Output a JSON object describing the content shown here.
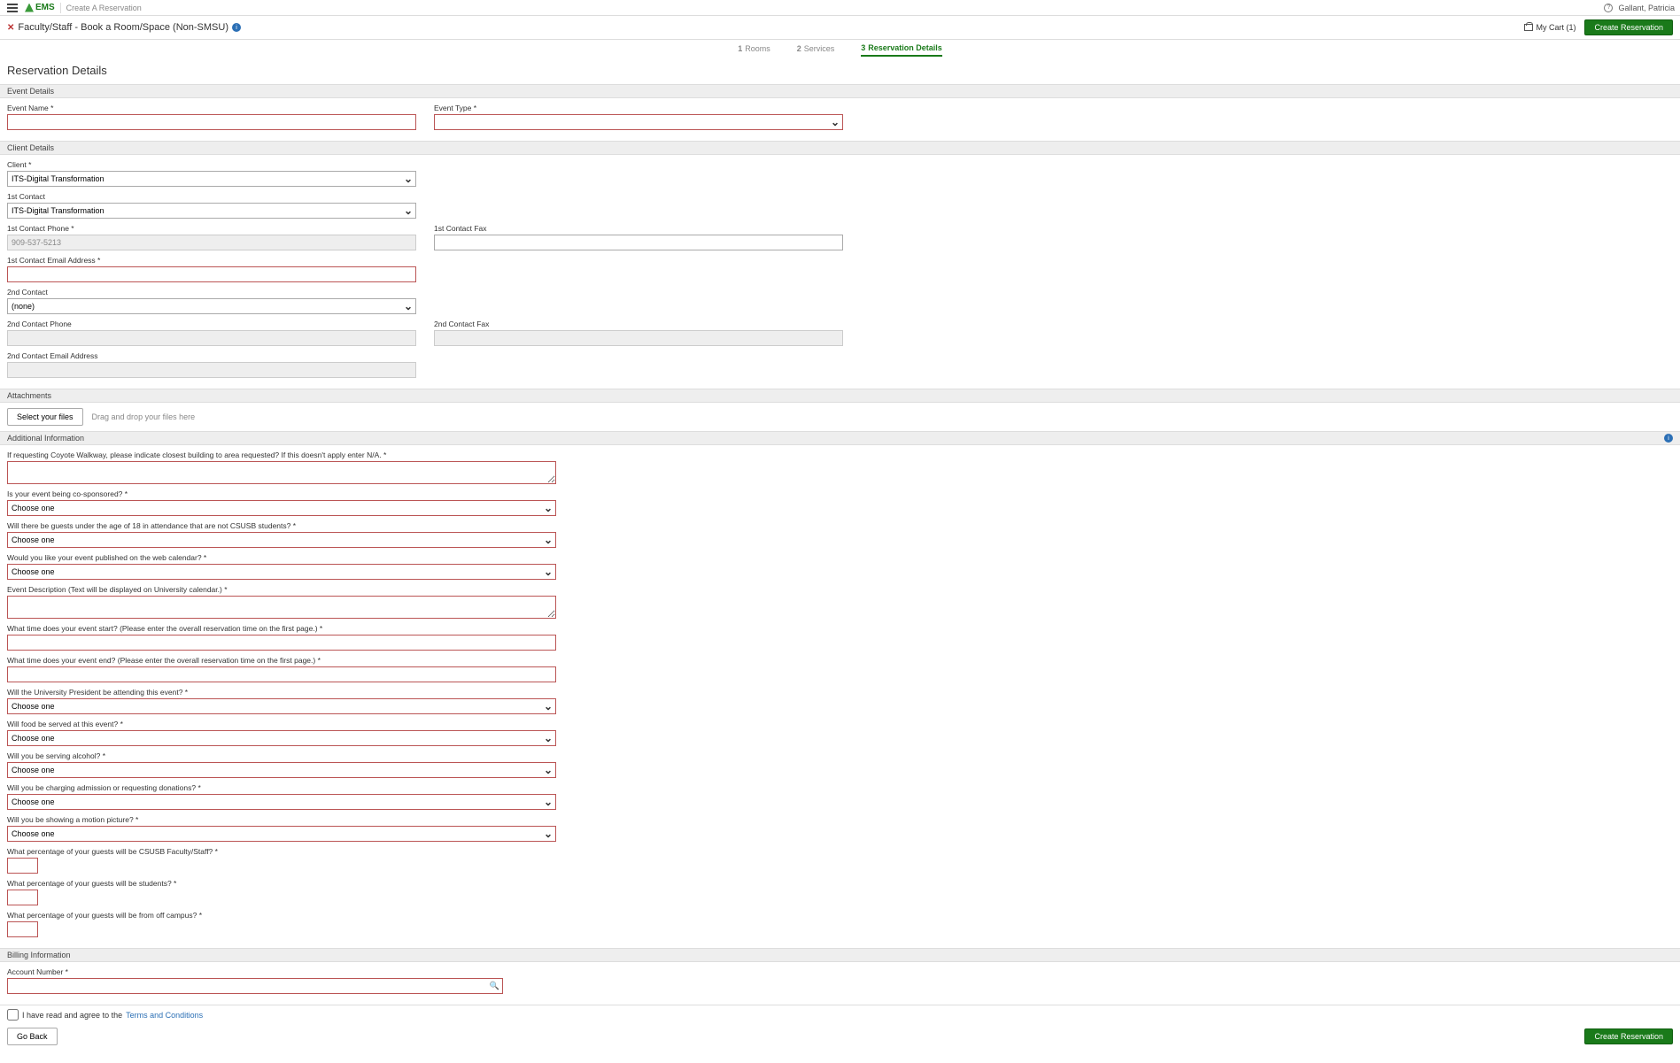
{
  "header": {
    "app_name": "EMS",
    "breadcrumb": "Create A Reservation",
    "user_name": "Gallant, Patricia"
  },
  "template": {
    "title": "Faculty/Staff - Book a Room/Space (Non-SMSU)",
    "cart_label": "My Cart (1)",
    "create_btn": "Create Reservation"
  },
  "tabs": {
    "rooms": {
      "num": "1",
      "label": "Rooms"
    },
    "services": {
      "num": "2",
      "label": "Services"
    },
    "details": {
      "num": "3",
      "label": "Reservation Details"
    }
  },
  "page_heading": "Reservation Details",
  "sections": {
    "event_details": "Event Details",
    "client_details": "Client Details",
    "attachments": "Attachments",
    "additional_info": "Additional Information",
    "billing_info": "Billing Information"
  },
  "event": {
    "name_label": "Event Name *",
    "type_label": "Event Type *"
  },
  "client": {
    "client_label": "Client *",
    "client_value": "ITS-Digital Transformation",
    "c1_label": "1st Contact",
    "c1_value": "ITS-Digital Transformation",
    "c1_phone_label": "1st Contact Phone *",
    "c1_phone_value": "909-537-5213",
    "c1_fax_label": "1st Contact Fax",
    "c1_email_label": "1st Contact Email Address *",
    "c2_label": "2nd Contact",
    "c2_value": "(none)",
    "c2_phone_label": "2nd Contact Phone",
    "c2_fax_label": "2nd Contact Fax",
    "c2_email_label": "2nd Contact Email Address"
  },
  "attach": {
    "select_btn": "Select your files",
    "drag_hint": "Drag and drop your files here"
  },
  "addl": {
    "coyote_walkway_label": "If requesting Coyote Walkway, please indicate closest building to area requested? If this doesn't apply enter N/A. *",
    "co_sponsored_label": "Is your event being co-sponsored? *",
    "under18_label": "Will there be guests under the age of 18 in attendance that are not CSUSB students? *",
    "publish_label": "Would you like your event published on the web calendar? *",
    "desc_label": "Event Description (Text will be displayed on University calendar.) *",
    "start_time_label": "What time does your event start? (Please enter the overall reservation time on the first page.) *",
    "end_time_label": "What time does your event end? (Please enter the overall reservation time on the first page.) *",
    "president_label": "Will the University President be attending this event? *",
    "food_label": "Will food be served at this event? *",
    "alcohol_label": "Will you be serving alcohol? *",
    "admission_label": "Will you be charging admission or requesting donations? *",
    "motion_label": "Will you be showing a motion picture? *",
    "pct_facstaff_label": "What percentage of your guests will be CSUSB Faculty/Staff? *",
    "pct_students_label": "What percentage of your guests will be students? *",
    "pct_offcampus_label": "What percentage of your guests will be from off campus? *",
    "choose_one": "Choose one"
  },
  "billing": {
    "account_label": "Account Number *"
  },
  "terms": {
    "text_prefix": "I have read and agree to the ",
    "link": "Terms and Conditions"
  },
  "footer": {
    "back_btn": "Go Back",
    "create_btn": "Create Reservation"
  }
}
